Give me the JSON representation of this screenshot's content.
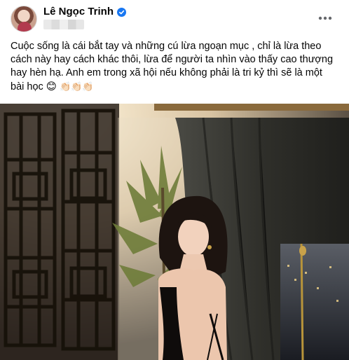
{
  "post": {
    "author": "Lê Ngọc Trinh",
    "caption_lines": [
      "Cuộc sống là cái bắt tay và những cú lừa ngoạn mục , chỉ là lừa theo",
      "cách này hay cách khác thôi, lừa để người ta nhìn vào thấy cao thượng",
      "hay hèn hạ. Anh em trong xã hội nếu không phải là tri kỷ thì sẽ là một",
      "bài học"
    ],
    "caption_emojis": [
      "😊",
      "👏🏻",
      "👏🏻",
      "👏🏻"
    ]
  },
  "icons": {
    "verified": "verified-badge-icon",
    "more": "more-options-icon"
  },
  "colors": {
    "verified_blue": "#1877f2",
    "text": "#050505",
    "icon_gray": "#65676b"
  }
}
